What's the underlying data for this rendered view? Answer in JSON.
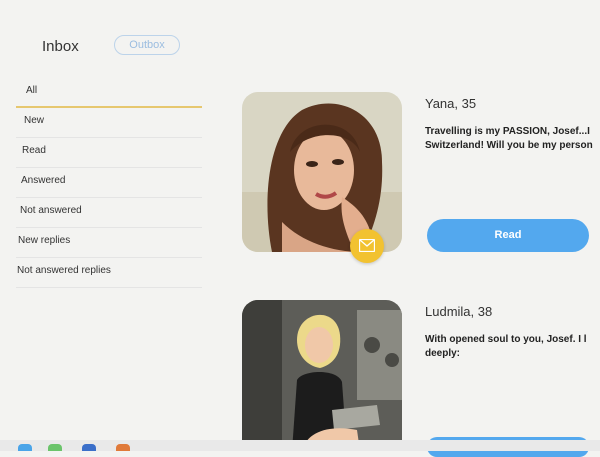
{
  "header": {
    "inbox_label": "Inbox",
    "outbox_label": "Outbox"
  },
  "sidebar": {
    "filters": [
      {
        "label": "All",
        "active": true
      },
      {
        "label": "New"
      },
      {
        "label": "Read"
      },
      {
        "label": "Answered"
      },
      {
        "label": "Not answered"
      },
      {
        "label": "New replies"
      },
      {
        "label": "Not answered replies"
      }
    ]
  },
  "messages": [
    {
      "name": "Yana, 35",
      "text": "Travelling is my PASSION, Josef...I\nSwitzerland! Will you be my person",
      "read_label": "Read",
      "icon": "mail-icon"
    },
    {
      "name": "Ludmila, 38",
      "text": "With opened soul to you, Josef. I l\ndeeply:",
      "read_label": ""
    }
  ],
  "colors": {
    "accent_blue": "#53a8ee",
    "badge_yellow": "#f2c230",
    "active_underline": "#e6c76f"
  }
}
